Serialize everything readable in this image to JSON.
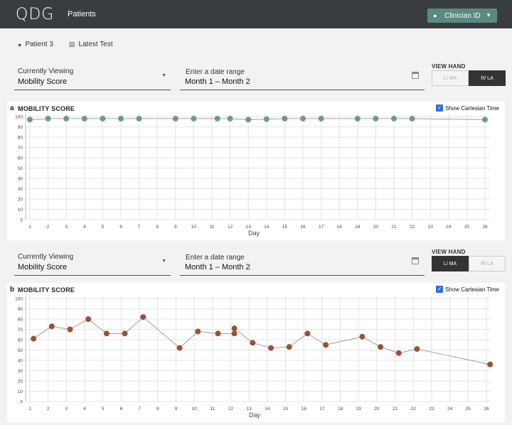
{
  "header": {
    "logo": "QDG",
    "nav_patients": "Patients",
    "clinician_label": "Clinician ID"
  },
  "subnav": {
    "patient": "Patient 3",
    "latest_test": "Latest Test"
  },
  "controls": [
    {
      "viewing_label": "Currently  Viewing",
      "viewing_value": "Mobility Score",
      "date_label": "Enter a date range",
      "date_value": "Month 1 – Month 2",
      "hand_title": "VIEW HAND",
      "hand_left": "L/ MA",
      "hand_right": "R/ LA",
      "active": "right"
    },
    {
      "viewing_label": "Currently  Viewing",
      "viewing_value": "Mobility Score",
      "date_label": "Enter a date range",
      "date_value": "Month 1 – Month 2",
      "hand_title": "VIEW HAND",
      "hand_left": "L/ MA",
      "hand_right": "R/ LA",
      "active": "left"
    }
  ],
  "panels": [
    {
      "label": "a",
      "title": "MOBILITY SCORE",
      "cartesian": "Show Cartesian Time"
    },
    {
      "label": "b",
      "title": "MOBILITY SCORE",
      "cartesian": "Show Cartesian Time"
    }
  ],
  "chart_data": [
    {
      "type": "line",
      "title": "MOBILITY SCORE",
      "xlabel": "Day",
      "ylabel": "",
      "ylim": [
        0,
        100
      ],
      "yticks": [
        0,
        10,
        20,
        30,
        40,
        50,
        60,
        70,
        80,
        90,
        100
      ],
      "xlim": [
        1,
        26
      ],
      "xticks": [
        1,
        2,
        3,
        4,
        5,
        6,
        7,
        8,
        9,
        10,
        11,
        12,
        13,
        14,
        15,
        16,
        17,
        18,
        19,
        20,
        21,
        22,
        23,
        24,
        25,
        26
      ],
      "grid": true,
      "color": "#6e9a8c",
      "x": [
        1,
        2,
        3,
        4,
        5,
        6,
        7,
        9,
        10,
        11.3,
        12,
        13,
        14,
        15,
        16,
        17,
        19,
        20,
        21,
        22,
        26
      ],
      "y": [
        97,
        98,
        98,
        98,
        98,
        98,
        98,
        98,
        98,
        98,
        98,
        97,
        97.5,
        98,
        98,
        98,
        98,
        98,
        98,
        98,
        97
      ]
    },
    {
      "type": "line",
      "title": "MOBILITY SCORE",
      "xlabel": "Day",
      "ylabel": "",
      "ylim": [
        0,
        100
      ],
      "yticks": [
        0,
        10,
        20,
        30,
        40,
        50,
        60,
        70,
        80,
        90,
        100
      ],
      "xlim": [
        1,
        26
      ],
      "xticks": [
        1,
        2,
        3,
        4,
        5,
        6,
        7,
        8,
        9,
        10,
        11,
        12,
        13,
        14,
        15,
        16,
        17,
        18,
        19,
        20,
        21,
        22,
        23,
        24,
        25,
        26
      ],
      "grid": true,
      "color": "#9c5035",
      "x": [
        1.2,
        2.2,
        3.2,
        4.2,
        5.2,
        6.2,
        7.2,
        9.2,
        10.2,
        11.3,
        12.2,
        12.2,
        13.2,
        14.2,
        15.2,
        16.2,
        17.2,
        19.2,
        20.2,
        21.2,
        22.2,
        26.2
      ],
      "y": [
        61,
        73,
        70,
        80,
        66,
        66,
        82,
        52,
        68,
        66,
        66,
        71,
        57,
        52,
        53,
        66,
        55,
        63,
        53,
        47,
        51,
        36
      ]
    }
  ]
}
